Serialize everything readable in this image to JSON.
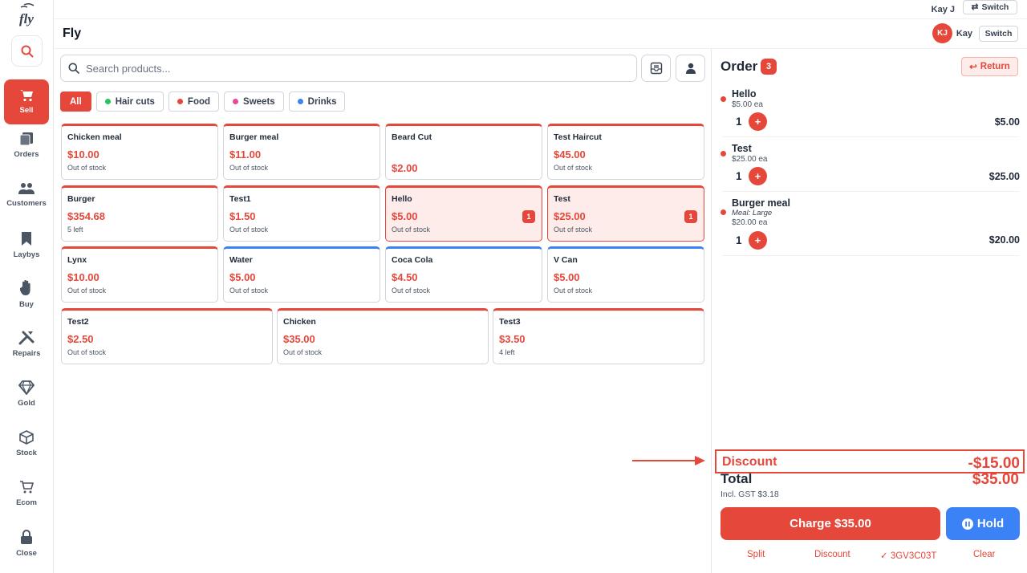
{
  "sidebar": {
    "logo_text": "fly",
    "items": [
      {
        "label": "Sell",
        "icon": "cart-icon",
        "active": true
      },
      {
        "label": "Orders",
        "icon": "orders-icon"
      },
      {
        "label": "Customers",
        "icon": "customers-icon"
      },
      {
        "label": "Laybys",
        "icon": "bookmark-icon"
      },
      {
        "label": "Buy",
        "icon": "hand-icon"
      },
      {
        "label": "Repairs",
        "icon": "tools-icon"
      },
      {
        "label": "Gold",
        "icon": "diamond-icon"
      },
      {
        "label": "Stock",
        "icon": "box-icon"
      },
      {
        "label": "Ecom",
        "icon": "ecom-cart-icon"
      },
      {
        "label": "Close",
        "icon": "lock-icon"
      }
    ]
  },
  "topbar": {
    "user": "Kay J",
    "switch_label": "Switch"
  },
  "header": {
    "store_name": "Fly",
    "avatar_initials": "KJ",
    "user_short": "Kay",
    "switch_label": "Switch"
  },
  "search": {
    "placeholder": "Search products..."
  },
  "categories": [
    {
      "label": "All",
      "active": true
    },
    {
      "label": "Hair cuts",
      "dot_color": "#22c55e"
    },
    {
      "label": "Food",
      "dot_color": "#e5483a"
    },
    {
      "label": "Sweets",
      "dot_color": "#ec4899"
    },
    {
      "label": "Drinks",
      "dot_color": "#3b82f6"
    }
  ],
  "products": [
    {
      "name": "Chicken meal",
      "price": "$10.00",
      "stock": "Out of stock"
    },
    {
      "name": "Burger meal",
      "price": "$11.00",
      "stock": "Out of stock"
    },
    {
      "name": "Beard Cut",
      "price": "$2.00",
      "stock": ""
    },
    {
      "name": "Test Haircut",
      "price": "$45.00",
      "stock": "Out of stock"
    },
    {
      "name": "Burger",
      "price": "$354.68",
      "stock": "5 left"
    },
    {
      "name": "Test1",
      "price": "$1.50",
      "stock": "Out of stock"
    },
    {
      "name": "Hello",
      "price": "$5.00",
      "stock": "Out of stock",
      "qty": "1"
    },
    {
      "name": "Test",
      "price": "$25.00",
      "stock": "Out of stock",
      "qty": "1"
    },
    {
      "name": "Lynx",
      "price": "$10.00",
      "stock": "Out of stock"
    },
    {
      "name": "Water",
      "price": "$5.00",
      "stock": "Out of stock"
    },
    {
      "name": "Coca Cola",
      "price": "$4.50",
      "stock": "Out of stock"
    },
    {
      "name": "V Can",
      "price": "$5.00",
      "stock": "Out of stock"
    },
    {
      "name": "Test2",
      "price": "$2.50",
      "stock": "Out of stock"
    },
    {
      "name": "Chicken",
      "price": "$35.00",
      "stock": "Out of stock"
    },
    {
      "name": "Test3",
      "price": "$3.50",
      "stock": "4 left"
    }
  ],
  "order": {
    "title": "Order",
    "count": "3",
    "return_label": "Return",
    "items": [
      {
        "name": "Hello",
        "each": "$5.00 ea",
        "qty": "1",
        "total": "$5.00"
      },
      {
        "name": "Test",
        "each": "$25.00 ea",
        "qty": "1",
        "total": "$25.00"
      },
      {
        "name": "Burger meal",
        "meta": "Meal: Large",
        "each": "$20.00 ea",
        "qty": "1",
        "total": "$20.00"
      }
    ],
    "discount_label": "Discount",
    "discount_value": "-$15.00",
    "total_label": "Total",
    "total_value": "$35.00",
    "gst": "Incl. GST $3.18",
    "charge_label": "Charge $35.00",
    "hold_label": "Hold",
    "footer": {
      "split": "Split",
      "discount": "Discount",
      "code": "✓ 3GV3C03T",
      "clear": "Clear"
    }
  },
  "colors": {
    "accent": "#e5483a",
    "blue": "#3b82f6"
  }
}
